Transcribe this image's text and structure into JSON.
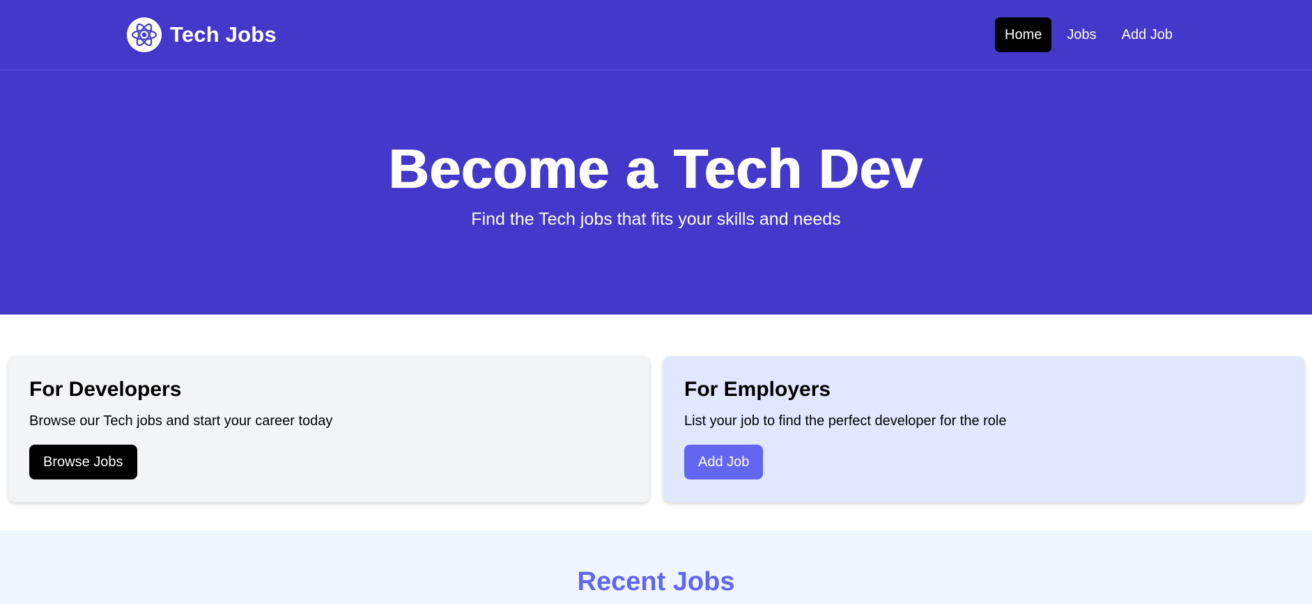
{
  "navbar": {
    "brand": "Tech Jobs",
    "logo_icon": "atom-icon",
    "links": [
      {
        "label": "Home",
        "active": true
      },
      {
        "label": "Jobs",
        "active": false
      },
      {
        "label": "Add Job",
        "active": false
      }
    ]
  },
  "hero": {
    "title": "Become a Tech Dev",
    "subtitle": "Find the Tech jobs that fits your skills and needs"
  },
  "cards": {
    "developers": {
      "title": "For Developers",
      "text": "Browse our Tech jobs and start your career today",
      "button": "Browse Jobs"
    },
    "employers": {
      "title": "For Employers",
      "text": "List your job to find the perfect developer for the role",
      "button": "Add Job"
    }
  },
  "recent_jobs": {
    "title": "Recent Jobs"
  },
  "colors": {
    "primary": "#4338ca",
    "accent": "#6366f1",
    "dev_card_bg": "#f3f4f6",
    "emp_card_bg": "#e0e7ff",
    "recent_bg": "#eff6ff"
  }
}
